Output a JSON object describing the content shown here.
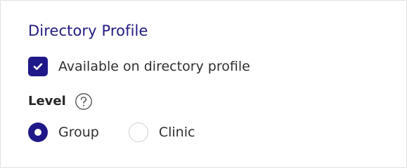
{
  "section": {
    "title": "Directory Profile"
  },
  "availability": {
    "label": "Available on directory profile",
    "checked": true
  },
  "level": {
    "label": "Level",
    "help_icon": "question-circle-icon",
    "options": [
      {
        "label": "Group",
        "selected": true
      },
      {
        "label": "Clinic",
        "selected": false
      }
    ]
  },
  "colors": {
    "accent": "#1f1888",
    "title": "#231b83",
    "text": "#2f2f2f",
    "border": "#e2e2e2"
  }
}
